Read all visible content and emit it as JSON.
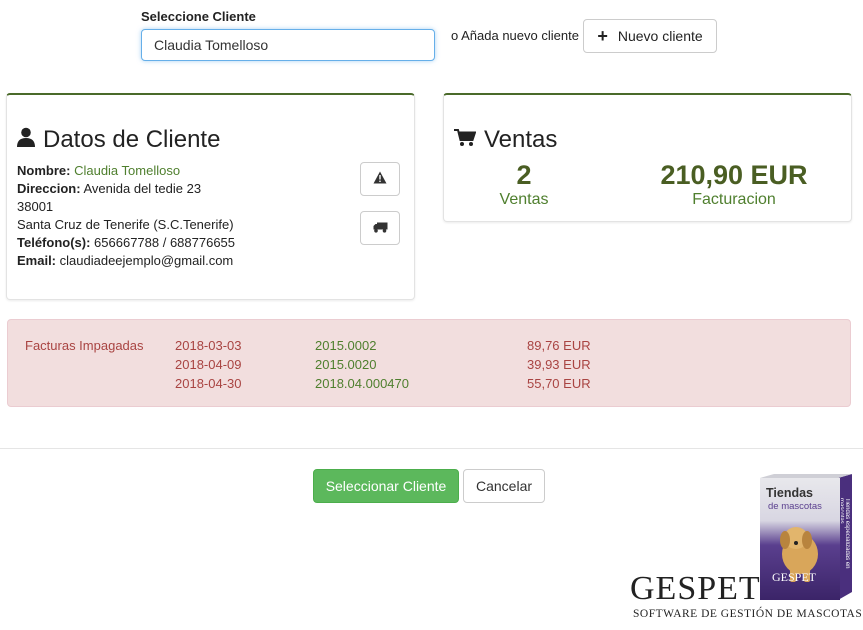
{
  "selector": {
    "label": "Seleccione Cliente",
    "value": "Claudia Tomelloso",
    "or_text": "o Añada nuevo cliente",
    "new_button": "Nuevo cliente"
  },
  "client": {
    "title": "Datos de Cliente",
    "name_label": "Nombre:",
    "name": "Claudia Tomelloso",
    "address_label": "Direccion:",
    "address": "Avenida del tedie 23",
    "postal": "38001",
    "city": "Santa Cruz de Tenerife (S.C.Tenerife)",
    "phone_label": "Teléfono(s):",
    "phone": "656667788 / 688776655",
    "email_label": "Email:",
    "email": "claudiadeejemplo@gmail.com",
    "icons": [
      "warning-icon",
      "truck-icon"
    ]
  },
  "sales": {
    "title": "Ventas",
    "count": "2",
    "count_label": "Ventas",
    "amount": "210,90 EUR",
    "amount_label": "Facturacion"
  },
  "unpaid": {
    "label": "Facturas Impagadas",
    "rows": [
      {
        "date": "2018-03-03",
        "number": "2015.0002",
        "amount": "89,76 EUR"
      },
      {
        "date": "2018-04-09",
        "number": "2015.0020",
        "amount": "39,93 EUR"
      },
      {
        "date": "2018-04-30",
        "number": "2018.04.000470",
        "amount": "55,70 EUR"
      }
    ]
  },
  "actions": {
    "select": "Seleccionar Cliente",
    "cancel": "Cancelar"
  },
  "brand": {
    "logo": "GESPET",
    "tagline": "SOFTWARE DE GESTIÓN DE MASCOTAS",
    "box_title": "Tiendas",
    "box_subtitle": "de mascotas",
    "box_logo": "GESPET",
    "box_side": "Tiendas especializadas en mascotas"
  },
  "colors": {
    "accent_green": "#4f7f2e",
    "dark_green": "#4a5e23",
    "danger_bg": "#f2dede",
    "danger_text": "#a94442",
    "success_button": "#5cb85c"
  }
}
